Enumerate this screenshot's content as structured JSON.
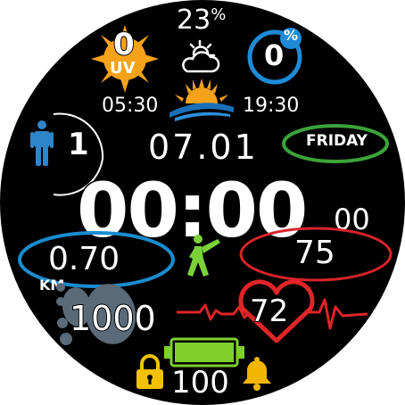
{
  "watchface": {
    "humidity": {
      "value": "23",
      "unit": "%"
    },
    "uv": {
      "value": "0",
      "label": "UV"
    },
    "rain_chance": {
      "value": "0",
      "unit": "%"
    },
    "sunrise": "05:30",
    "sunset": "19:30",
    "floors": "1",
    "date": "07.01",
    "weekday": "FRIDAY",
    "time": "00:00",
    "seconds": "00",
    "distance": {
      "value": "0.70",
      "unit": "KM"
    },
    "calories": "75",
    "steps": "1000",
    "heart_rate": "72",
    "battery": {
      "value": "100",
      "level": 1.0
    },
    "icons": [
      "sun-icon",
      "partly-cloudy-icon",
      "sunrise-icon",
      "person-icon",
      "exercise-icon",
      "footprints-icon",
      "heartbeat-icon",
      "heart-icon",
      "battery-icon",
      "lock-icon",
      "bell-icon"
    ],
    "colors": {
      "background": "#000000",
      "text": "#ffffff",
      "uv_sun": "#f5a21b",
      "rain_ring": "#1f8ad6",
      "weekday_ring": "#3ca33a",
      "distance_ring": "#1a8ccf",
      "calories_ring": "#d8232a",
      "person": "#2e86c8",
      "exercise": "#7bd13a",
      "heart": "#e02428",
      "battery": "#7fcf2a",
      "lock": "#f2c200",
      "bell": "#f2b600"
    }
  }
}
